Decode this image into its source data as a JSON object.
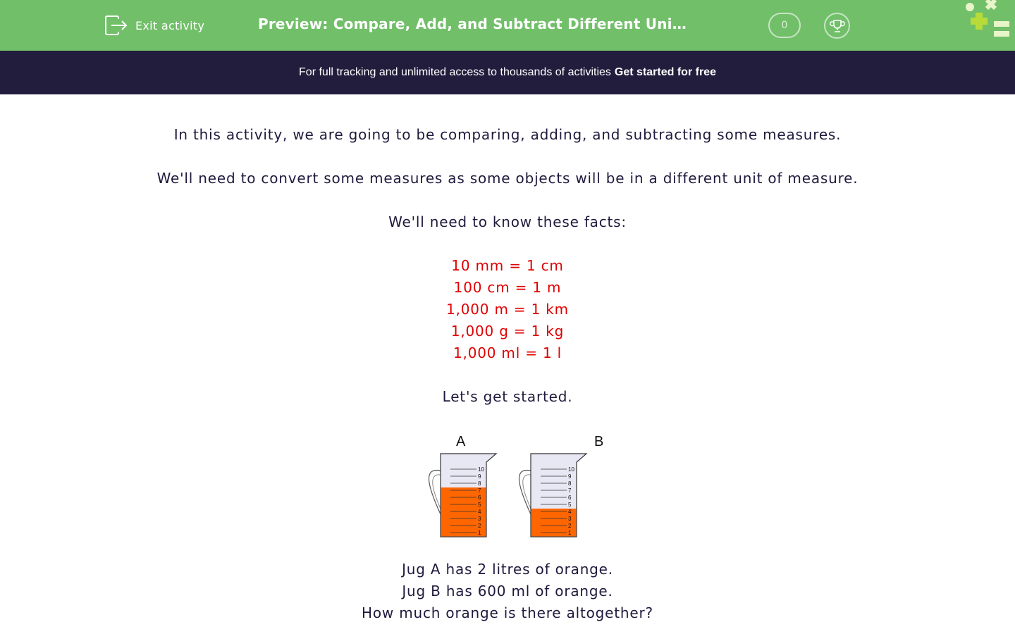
{
  "header": {
    "exit_label": "Exit activity",
    "title": "Preview: Compare, Add, and Subtract Different Units of Measure",
    "score": "0",
    "colors": {
      "bar": "#72bf6a"
    },
    "icons": [
      "exit-icon",
      "trophy-icon",
      "logo"
    ]
  },
  "banner": {
    "text": "For full tracking and unlimited access to thousands of activities",
    "link": "Get started for free",
    "color": "#231d3d"
  },
  "intro": {
    "p1": "In this activity, we are going to be comparing, adding, and subtracting some measures.",
    "p2": "We'll need to convert some measures as some objects will be in a different unit of measure.",
    "p3": "We'll need to know these facts:",
    "facts": [
      "10 mm = 1 cm",
      "100 cm = 1 m",
      "1,000 m = 1 km",
      "1,000 g = 1 kg",
      "1,000 ml = 1 l"
    ],
    "fact_color": "#e00000",
    "p4": "Let's get started."
  },
  "jugs": {
    "labels": [
      "A",
      "B"
    ],
    "scale": [
      "10",
      "9",
      "8",
      "7",
      "6",
      "5",
      "4",
      "3",
      "2",
      "1"
    ],
    "fill_levels": [
      7,
      4
    ],
    "liquid_color": "#ff6600"
  },
  "questions": {
    "q1": "Jug A has 2 litres of orange.",
    "q2": "Jug B has 600 ml of orange.",
    "q3": "How much orange is there altogether?"
  }
}
